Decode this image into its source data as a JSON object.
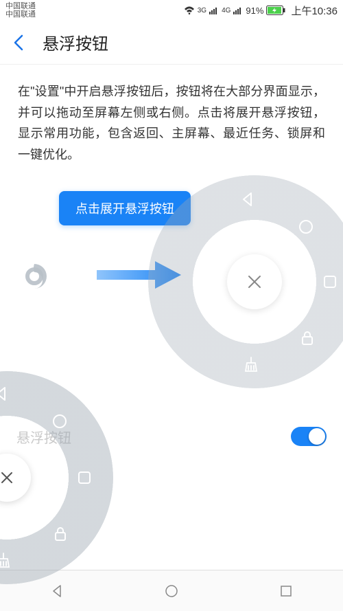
{
  "status": {
    "carrier_line1": "中国联通",
    "carrier_line2": "中国联通",
    "network_3g": "3G",
    "network_4g": "4G",
    "battery_pct": "91%",
    "time": "上午10:36"
  },
  "header": {
    "title": "悬浮按钮"
  },
  "body": {
    "description": "在\"设置\"中开启悬浮按钮后，按钮将在大部分界面显示，并可以拖动至屏幕左侧或右侧。点击将展开悬浮按钮，显示常用功能，包含返回、主屏幕、最近任务、锁屏和一键优化。",
    "tooltip": "点击展开悬浮按钮"
  },
  "setting": {
    "label": "悬浮按钮",
    "enabled": true
  },
  "radial_items": {
    "back": "back-triangle-icon",
    "home": "circle-icon",
    "recent": "square-icon",
    "lock": "lock-icon",
    "optimize": "broom-icon"
  },
  "icons": {
    "close": "✕"
  }
}
